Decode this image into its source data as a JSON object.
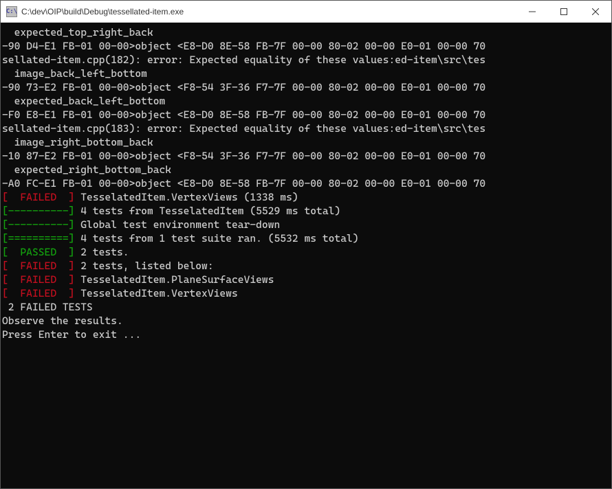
{
  "titlebar": {
    "icon_label": "C:\\",
    "title": "C:\\dev\\OIP\\build\\Debug\\tessellated-item.exe"
  },
  "terminal": [
    {
      "segments": [
        {
          "cls": "white",
          "text": "  expected_top_right_back"
        }
      ]
    },
    {
      "segments": [
        {
          "cls": "white",
          "text": "-90 D4-E1 FB-01 00-00>object <E8-D0 8E-58 FB-7F 00-00 80-02 00-00 E0-01 00-00 70"
        }
      ]
    },
    {
      "segments": [
        {
          "cls": "white",
          "text": "sellated-item.cpp(182): error: Expected equality of these values:ed-item\\src\\tes"
        }
      ]
    },
    {
      "segments": [
        {
          "cls": "white",
          "text": "  image_back_left_bottom"
        }
      ]
    },
    {
      "segments": [
        {
          "cls": "white",
          "text": "-90 73-E2 FB-01 00-00>object <F8-54 3F-36 F7-7F 00-00 80-02 00-00 E0-01 00-00 70"
        }
      ]
    },
    {
      "segments": [
        {
          "cls": "white",
          "text": "  expected_back_left_bottom"
        }
      ]
    },
    {
      "segments": [
        {
          "cls": "white",
          "text": "-F0 E8-E1 FB-01 00-00>object <E8-D0 8E-58 FB-7F 00-00 80-02 00-00 E0-01 00-00 70"
        }
      ]
    },
    {
      "segments": [
        {
          "cls": "white",
          "text": "sellated-item.cpp(183): error: Expected equality of these values:ed-item\\src\\tes"
        }
      ]
    },
    {
      "segments": [
        {
          "cls": "white",
          "text": "  image_right_bottom_back"
        }
      ]
    },
    {
      "segments": [
        {
          "cls": "white",
          "text": "-10 87-E2 FB-01 00-00>object <F8-54 3F-36 F7-7F 00-00 80-02 00-00 E0-01 00-00 70"
        }
      ]
    },
    {
      "segments": [
        {
          "cls": "white",
          "text": "  expected_right_bottom_back"
        }
      ]
    },
    {
      "segments": [
        {
          "cls": "white",
          "text": "-A0 FC-E1 FB-01 00-00>object <E8-D0 8E-58 FB-7F 00-00 80-02 00-00 E0-01 00-00 70"
        }
      ]
    },
    {
      "segments": [
        {
          "cls": "red",
          "text": "[  FAILED  ]"
        },
        {
          "cls": "white",
          "text": " TesselatedItem.VertexViews (1338 ms)"
        }
      ]
    },
    {
      "segments": [
        {
          "cls": "green",
          "text": "[----------]"
        },
        {
          "cls": "white",
          "text": " 4 tests from TesselatedItem (5529 ms total)"
        }
      ]
    },
    {
      "segments": [
        {
          "cls": "white",
          "text": ""
        }
      ]
    },
    {
      "segments": [
        {
          "cls": "green",
          "text": "[----------]"
        },
        {
          "cls": "white",
          "text": " Global test environment tear-down"
        }
      ]
    },
    {
      "segments": [
        {
          "cls": "green",
          "text": "[==========]"
        },
        {
          "cls": "white",
          "text": " 4 tests from 1 test suite ran. (5532 ms total)"
        }
      ]
    },
    {
      "segments": [
        {
          "cls": "green",
          "text": "[  PASSED  ]"
        },
        {
          "cls": "white",
          "text": " 2 tests."
        }
      ]
    },
    {
      "segments": [
        {
          "cls": "red",
          "text": "[  FAILED  ]"
        },
        {
          "cls": "white",
          "text": " 2 tests, listed below:"
        }
      ]
    },
    {
      "segments": [
        {
          "cls": "red",
          "text": "[  FAILED  ]"
        },
        {
          "cls": "white",
          "text": " TesselatedItem.PlaneSurfaceViews"
        }
      ]
    },
    {
      "segments": [
        {
          "cls": "red",
          "text": "[  FAILED  ]"
        },
        {
          "cls": "white",
          "text": " TesselatedItem.VertexViews"
        }
      ]
    },
    {
      "segments": [
        {
          "cls": "white",
          "text": ""
        }
      ]
    },
    {
      "segments": [
        {
          "cls": "white",
          "text": " 2 FAILED TESTS"
        }
      ]
    },
    {
      "segments": [
        {
          "cls": "white",
          "text": "Observe the results."
        }
      ]
    },
    {
      "segments": [
        {
          "cls": "white",
          "text": "Press Enter to exit ..."
        }
      ]
    }
  ]
}
